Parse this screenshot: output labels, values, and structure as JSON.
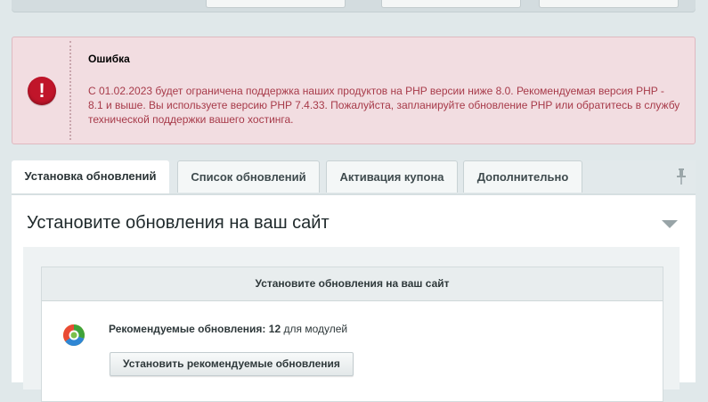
{
  "error": {
    "title": "Ошибка",
    "message": "С 01.02.2023 будет ограничена поддержка наших продуктов на PHP версии ниже 8.0. Рекомендуемая версия PHP - 8.1 и выше. Вы используете версию PHP 7.4.33. Пожалуйста, запланируйте обновление PHP или обратитесь в службу технической поддержки вашего хостинга.",
    "icon": "exclamation-icon",
    "icon_glyph": "!"
  },
  "tabs": [
    {
      "label": "Установка обновлений",
      "active": true
    },
    {
      "label": "Список обновлений",
      "active": false
    },
    {
      "label": "Активация купона",
      "active": false
    },
    {
      "label": "Дополнительно",
      "active": false
    }
  ],
  "section": {
    "title": "Установите обновления на ваш сайт"
  },
  "panel": {
    "header": "Установите обновления на ваш сайт",
    "recommended_label": "Рекомендуемые обновления:",
    "recommended_count": "12",
    "recommended_suffix": "для модулей",
    "install_button": "Установить рекомендуемые обновления"
  },
  "colors": {
    "error_bg": "#f2dde1",
    "error_text": "#a73a49",
    "error_icon": "#c0152a"
  }
}
